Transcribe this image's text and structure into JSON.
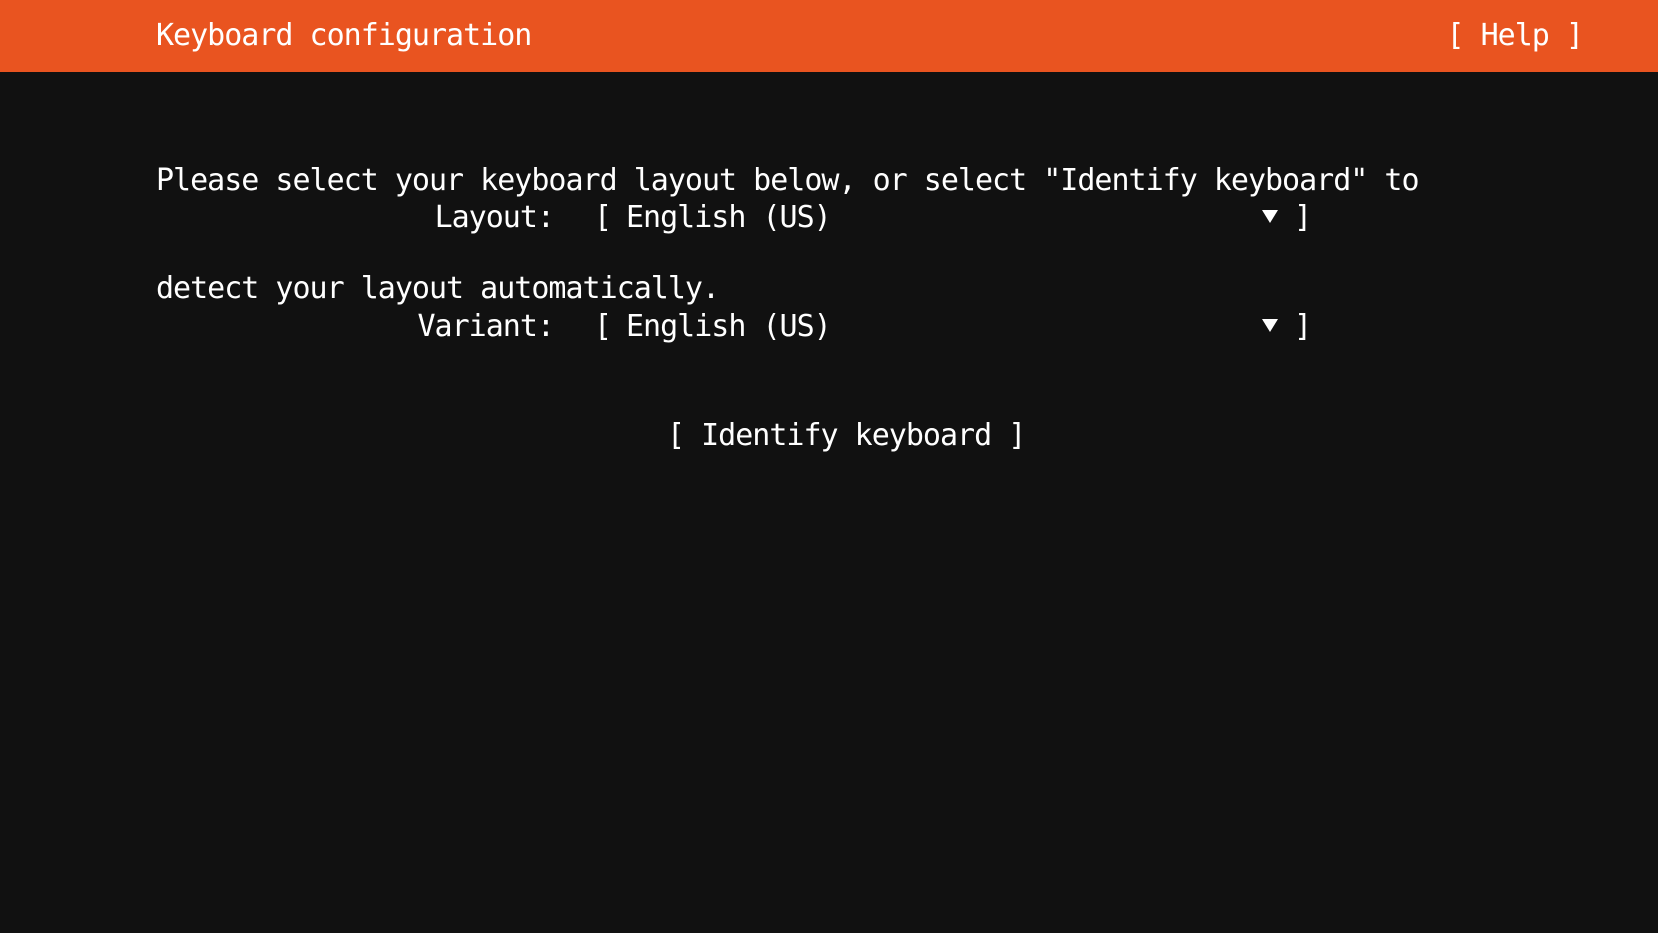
{
  "header": {
    "title": "Keyboard configuration",
    "help_label": "[ Help ]"
  },
  "intro": {
    "line1": "Please select your keyboard layout below, or select \"Identify keyboard\" to",
    "line2": "detect your layout automatically."
  },
  "layout_field": {
    "label": "Layout:",
    "value": "English (US)"
  },
  "variant_field": {
    "label": "Variant:",
    "value": "English (US)"
  },
  "identify_button": {
    "label": "[ Identify keyboard ]"
  },
  "colors": {
    "header_bg": "#e95420",
    "background": "#111111",
    "text": "#ffffff"
  },
  "icons": {
    "dropdown": "triangle-down-icon"
  }
}
